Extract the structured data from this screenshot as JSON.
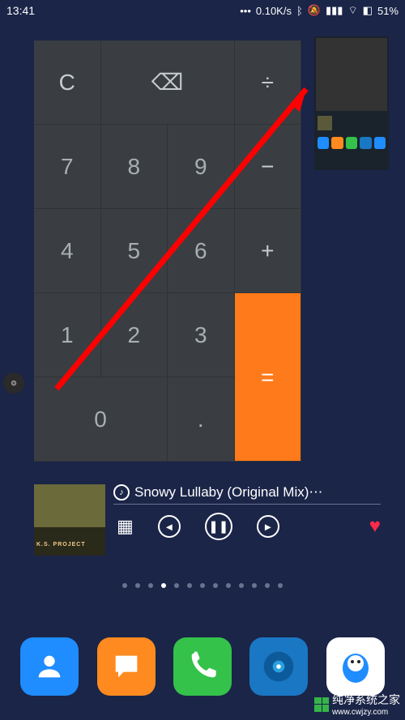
{
  "status": {
    "time": "13:41",
    "net_speed": "0.10K/s",
    "battery": "51%"
  },
  "calculator": {
    "keys": {
      "clear": "C",
      "backspace": "⌫",
      "divide": "÷",
      "seven": "7",
      "eight": "8",
      "nine": "9",
      "minus": "−",
      "four": "4",
      "five": "5",
      "six": "6",
      "plus": "+",
      "one": "1",
      "two": "2",
      "three": "3",
      "equals": "=",
      "zero": "0",
      "dot": "."
    }
  },
  "music": {
    "title": "Snowy Lullaby (Original Mix)⋯",
    "album_art_label": "K.S. PROJECT",
    "app_icon": "netease-music"
  },
  "pagination": {
    "count": 13,
    "active": 3
  },
  "dock": {
    "apps": [
      {
        "name": "contacts",
        "color": "#1f8cff"
      },
      {
        "name": "messages",
        "color": "#ff8a1f"
      },
      {
        "name": "phone",
        "color": "#34c24a"
      },
      {
        "name": "browser",
        "color": "#1a77c4"
      },
      {
        "name": "qq",
        "color": "#1f8cff"
      }
    ]
  },
  "watermark": {
    "line1": "纯净系统之家",
    "line2": "www.cwjzy.com"
  }
}
